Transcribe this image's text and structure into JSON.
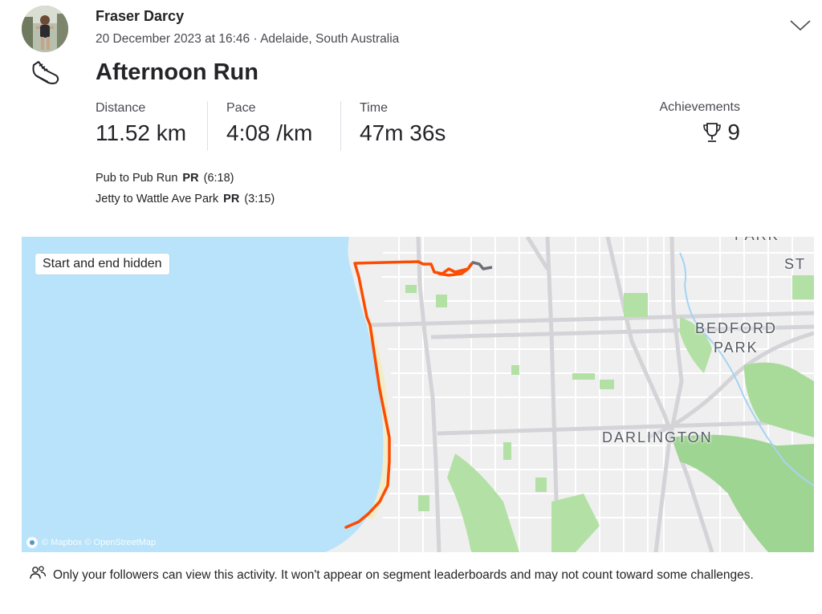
{
  "activity": {
    "athlete_name": "Fraser Darcy",
    "meta": "20 December 2023 at 16:46 · Adelaide, South Australia",
    "sport_icon": "running-shoe-icon",
    "title": "Afternoon Run"
  },
  "stats": [
    {
      "label": "Distance",
      "value": "11.52 km"
    },
    {
      "label": "Pace",
      "value": "4:08 /km"
    },
    {
      "label": "Time",
      "value": "47m 36s"
    }
  ],
  "achievements": {
    "label": "Achievements",
    "icon": "trophy-icon",
    "count": "9"
  },
  "segments": [
    {
      "name": "Pub to Pub Run",
      "badge": "PR",
      "time": "(6:18)"
    },
    {
      "name": "Jetty to Wattle Ave Park",
      "badge": "PR",
      "time": "(3:15)"
    }
  ],
  "map": {
    "badge": "Start and end hidden",
    "attribution": "© Mapbox © OpenStreetMap",
    "labels": {
      "bedford_1": "BEDFORD",
      "bedford_2": "PARK",
      "darlington": "DARLINGTON",
      "st": "ST",
      "park_top": "PARK"
    },
    "colors": {
      "sea": "#b8e3fa",
      "route": "#fc4c02",
      "hidden_route": "#6d6d78",
      "land": "#efefef",
      "park": "#b3e0a4"
    }
  },
  "privacy": {
    "icon": "followers-icon",
    "text": "Only your followers can view this activity. It won't appear on segment leaderboards and may not count toward some challenges."
  }
}
